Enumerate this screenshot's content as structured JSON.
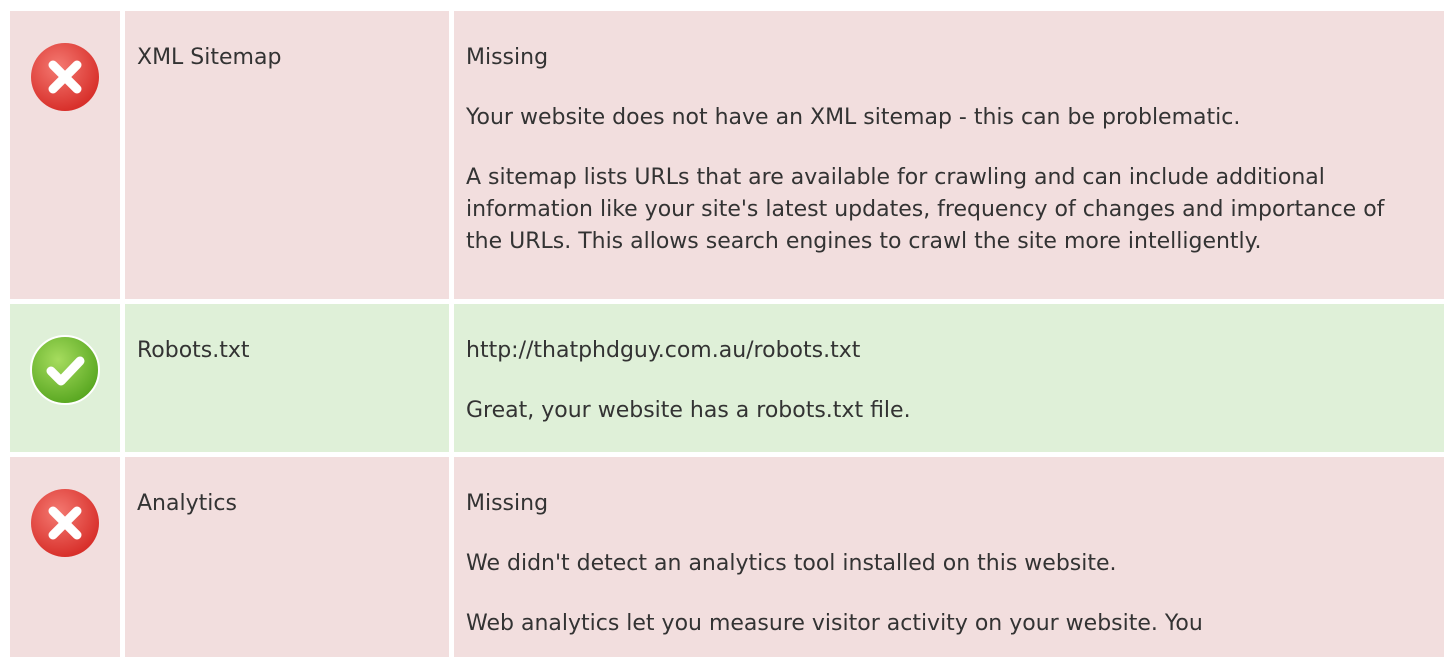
{
  "colors": {
    "fail_bg": "#f2dede",
    "pass_bg": "#dff0d8",
    "fail_icon": "#e0403c",
    "pass_icon": "#6cbf2f"
  },
  "rows": [
    {
      "status": "fail",
      "icon": "error-x-icon",
      "name": "XML Sitemap",
      "value": "Missing",
      "paragraphs": [
        "Your website does not have an XML sitemap - this can be problematic.",
        "A sitemap lists URLs that are available for crawling and can include additional information like your site's latest updates, frequency of changes and importance of the URLs. This allows search engines to crawl the site more intelligently."
      ]
    },
    {
      "status": "pass",
      "icon": "success-check-icon",
      "name": "Robots.txt",
      "value": "http://thatphdguy.com.au/robots.txt",
      "paragraphs": [
        "Great, your website has a robots.txt file."
      ]
    },
    {
      "status": "fail",
      "icon": "error-x-icon",
      "name": "Analytics",
      "value": "Missing",
      "paragraphs": [
        "We didn't detect an analytics tool installed on this website.",
        "Web analytics let you measure visitor activity on your website. You"
      ]
    }
  ]
}
